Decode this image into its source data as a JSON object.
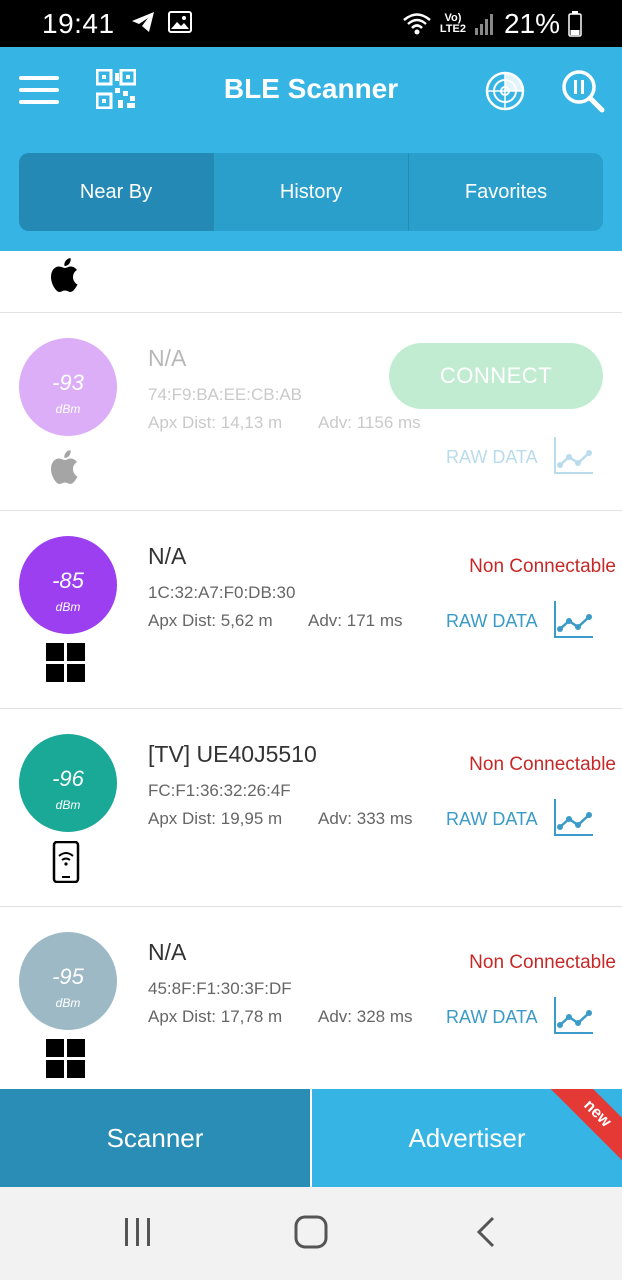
{
  "status_bar": {
    "time": "19:41",
    "lte_line1": "Vo)",
    "lte_line2": "LTE2",
    "battery": "21%"
  },
  "header": {
    "title": "BLE Scanner",
    "tabs": [
      {
        "label": "Near By",
        "active": true
      },
      {
        "label": "History",
        "active": false
      },
      {
        "label": "Favorites",
        "active": false
      }
    ]
  },
  "devices": [
    {
      "name": "N/A",
      "rssi": "-93",
      "unit": "dBm",
      "mac": "74:F9:BA:EE:CB:AB",
      "dist": "Apx Dist: 14,13 m",
      "adv": "Adv: 1156 ms",
      "action": "CONNECT",
      "raw": "RAW DATA",
      "brand_icon": "apple-icon",
      "color": "#c87ff0"
    },
    {
      "name": "N/A",
      "rssi": "-85",
      "unit": "dBm",
      "mac": "1C:32:A7:F0:DB:30",
      "dist": "Apx Dist: 5,62 m",
      "adv": "Adv: 171 ms",
      "status": "Non Connectable",
      "raw": "RAW DATA",
      "brand_icon": "windows-icon",
      "color": "#9b3ff0"
    },
    {
      "name": "[TV] UE40J5510",
      "rssi": "-96",
      "unit": "dBm",
      "mac": "FC:F1:36:32:26:4F",
      "dist": "Apx Dist: 19,95 m",
      "adv": "Adv: 333 ms",
      "status": "Non Connectable",
      "raw": "RAW DATA",
      "brand_icon": "phone-icon",
      "color": "#1aa897"
    },
    {
      "name": "N/A",
      "rssi": "-95",
      "unit": "dBm",
      "mac": "45:8F:F1:30:3F:DF",
      "dist": "Apx Dist: 17,78 m",
      "adv": "Adv: 328 ms",
      "status": "Non Connectable",
      "raw": "RAW DATA",
      "brand_icon": "windows-icon",
      "color": "#9eb9c6"
    }
  ],
  "bottom_tabs": {
    "scanner": "Scanner",
    "advertiser": "Advertiser",
    "badge": "new"
  },
  "colors": {
    "accent": "#36b4e4",
    "accent_dark": "#2a8db5",
    "error": "#c62828",
    "link": "#3a9bc8"
  }
}
